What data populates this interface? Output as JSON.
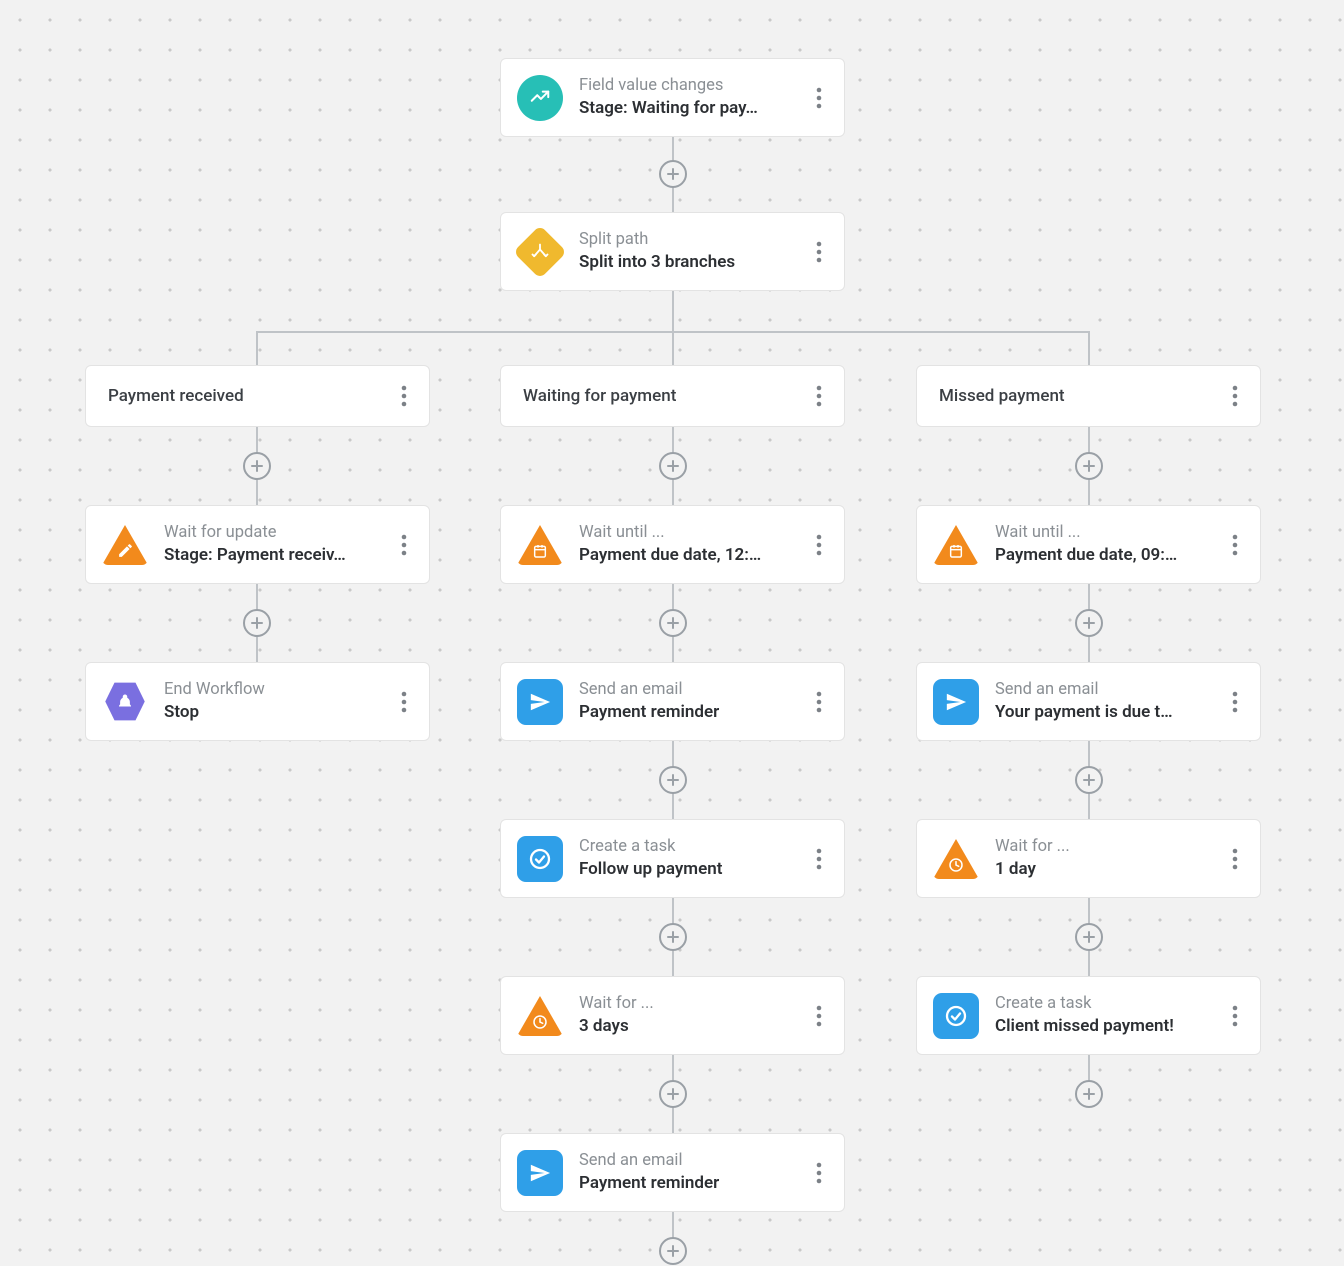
{
  "trigger": {
    "title": "Field value changes",
    "sub": "Stage: Waiting for pay…"
  },
  "split": {
    "title": "Split path",
    "sub": "Split into 3 branches"
  },
  "branches": {
    "a": {
      "label": "Payment received"
    },
    "b": {
      "label": "Waiting for payment"
    },
    "c": {
      "label": "Missed payment"
    }
  },
  "colA": {
    "n1": {
      "title": "Wait for update",
      "sub": "Stage: Payment receiv…"
    },
    "n2": {
      "title": "End Workflow",
      "sub": "Stop"
    }
  },
  "colB": {
    "n1": {
      "title": "Wait until ...",
      "sub": "Payment due date, 12:…"
    },
    "n2": {
      "title": "Send an email",
      "sub": "Payment reminder"
    },
    "n3": {
      "title": "Create a task",
      "sub": "Follow up payment"
    },
    "n4": {
      "title": "Wait for ...",
      "sub": "3 days"
    },
    "n5": {
      "title": "Send an email",
      "sub": "Payment reminder"
    }
  },
  "colC": {
    "n1": {
      "title": "Wait until ...",
      "sub": "Payment due date, 09:…"
    },
    "n2": {
      "title": "Send an email",
      "sub": "Your payment is due t…"
    },
    "n3": {
      "title": "Wait for ...",
      "sub": "1 day"
    },
    "n4": {
      "title": "Create a task",
      "sub": "Client missed payment!"
    }
  },
  "colors": {
    "teal": "#27bfb6",
    "yellow": "#f0b92e",
    "orange": "#f28a1c",
    "blue": "#2f9fe8",
    "purple": "#7a6fe0"
  }
}
